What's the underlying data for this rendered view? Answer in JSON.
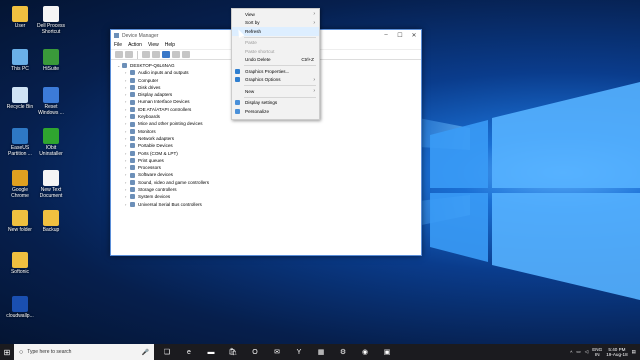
{
  "desktop_icons": [
    {
      "label": "User",
      "color": "#f0c040"
    },
    {
      "label": "Dell Process Shortcut",
      "color": "#f5f5f5"
    },
    {
      "label": "This PC",
      "color": "#6ab0e8"
    },
    {
      "label": "HiSuite",
      "color": "#3a9a3a"
    },
    {
      "label": "Recycle Bin",
      "color": "#cfe3f5"
    },
    {
      "label": "Reset Windows ...",
      "color": "#3c7bd8"
    },
    {
      "label": "EaseUS Partition ...",
      "color": "#2e78c4"
    },
    {
      "label": "IObit Uninstaller",
      "color": "#2fa52f"
    },
    {
      "label": "Google Chrome",
      "color": "#e0a020"
    },
    {
      "label": "New Text Document",
      "color": "#f5f5f5"
    },
    {
      "label": "New folder",
      "color": "#f0c040"
    },
    {
      "label": "Backup",
      "color": "#f0c040"
    },
    {
      "label": "Softonic",
      "color": "#f0c040"
    },
    {
      "label": "cloudwallp...",
      "color": "#1a4fb0"
    }
  ],
  "device_manager": {
    "title": "Device Manager",
    "menu": [
      "File",
      "Action",
      "View",
      "Help"
    ],
    "root": "DESKTOP-Q6L6NAG",
    "items": [
      "Audio inputs and outputs",
      "Computer",
      "Disk drives",
      "Display adapters",
      "Human Interface Devices",
      "IDE ATA/ATAPI controllers",
      "Keyboards",
      "Mice and other pointing devices",
      "Monitors",
      "Network adapters",
      "Portable Devices",
      "Ports (COM & LPT)",
      "Print queues",
      "Processors",
      "Software devices",
      "Sound, video and game controllers",
      "Storage controllers",
      "System devices",
      "Universal Serial Bus controllers"
    ]
  },
  "context_menu": {
    "items": [
      {
        "label": "View",
        "submenu": true
      },
      {
        "label": "Sort by",
        "submenu": true
      },
      {
        "label": "Refresh",
        "highlighted": true
      },
      {
        "sep": true
      },
      {
        "label": "Paste",
        "disabled": true
      },
      {
        "label": "Paste shortcut",
        "disabled": true
      },
      {
        "label": "Undo Delete",
        "shortcut": "Ctrl+Z"
      },
      {
        "sep": true
      },
      {
        "label": "Graphics Properties...",
        "icon_color": "#2f7fd0"
      },
      {
        "label": "Graphics Options",
        "submenu": true,
        "icon_color": "#2f7fd0"
      },
      {
        "sep": true
      },
      {
        "label": "New",
        "submenu": true
      },
      {
        "sep": true
      },
      {
        "label": "Display settings",
        "icon_color": "#4a90d9"
      },
      {
        "label": "Personalize",
        "icon_color": "#4a90d9"
      }
    ]
  },
  "taskbar": {
    "search_placeholder": "Type here to search",
    "apps": [
      "task-view",
      "edge",
      "file-explorer",
      "store",
      "outlook",
      "mail",
      "yandex",
      "notepad",
      "settings",
      "chrome",
      "other"
    ],
    "language": "ENG",
    "region": "IN",
    "time": "5:40 PM",
    "date": "19-Aug-18"
  }
}
